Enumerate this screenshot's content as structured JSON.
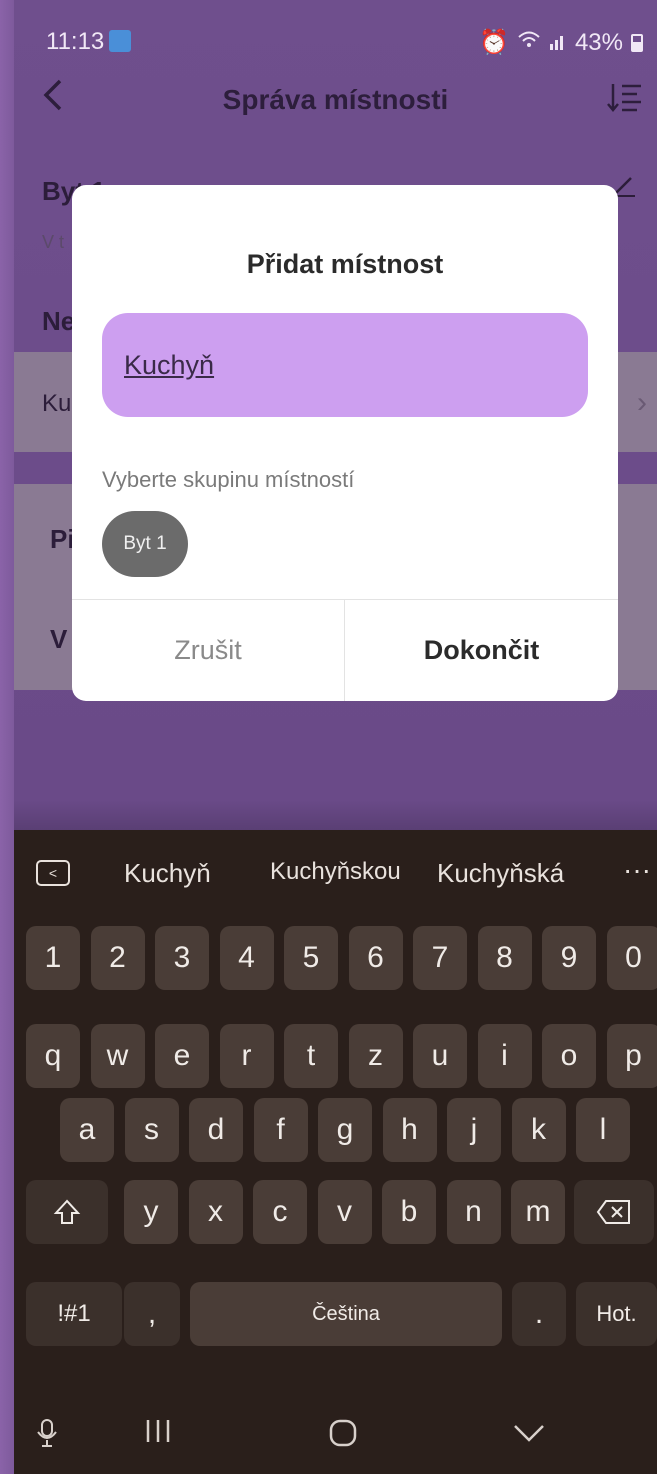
{
  "status_bar": {
    "time": "11:13",
    "battery": "43%"
  },
  "header": {
    "back": "<",
    "title": "Správa místnosti",
    "sort_icon": "sort-icon"
  },
  "background": {
    "group_title": "Byt 1",
    "group_sub": "V t",
    "section_label": "Ne",
    "row_label": "Ku",
    "action1": "Pi",
    "action2": "V"
  },
  "dialog": {
    "title": "Přidat místnost",
    "input_value": "Kuchyň",
    "group_label": "Vyberte skupinu místností",
    "chip": "Byt 1",
    "cancel": "Zrušit",
    "done": "Dokončit"
  },
  "keyboard": {
    "suggestions": [
      "Kuchyň",
      "Kuchyňskou",
      "Kuchyňská"
    ],
    "more": "···",
    "numbers": [
      "1",
      "2",
      "3",
      "4",
      "5",
      "6",
      "7",
      "8",
      "9",
      "0"
    ],
    "row1": [
      "q",
      "w",
      "e",
      "r",
      "t",
      "z",
      "u",
      "i",
      "o",
      "p"
    ],
    "row2": [
      "a",
      "s",
      "d",
      "f",
      "g",
      "h",
      "j",
      "k",
      "l"
    ],
    "row3": [
      "y",
      "x",
      "c",
      "v",
      "b",
      "n",
      "m"
    ],
    "symbols": "!#1",
    "comma": ",",
    "space": "Čeština",
    "period": ".",
    "hot": "Hot."
  },
  "colors": {
    "accent": "#cd9ff0",
    "overlay": "#6a4a88",
    "keyboard": "#2a1f1b"
  }
}
